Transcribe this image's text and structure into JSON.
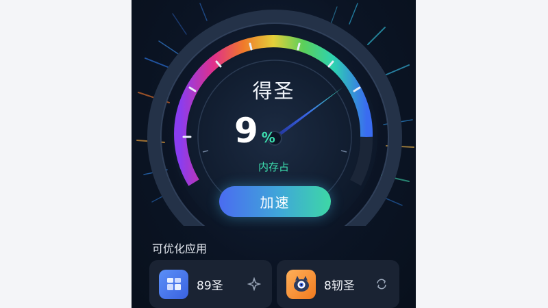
{
  "gauge": {
    "title": "得圣",
    "value": "9",
    "unit": "%",
    "sublabel": "内存占",
    "level_percent": 90
  },
  "boost_button": {
    "label": "加速"
  },
  "apps_section": {
    "title": "可优化应用",
    "items": [
      {
        "label": "89圣",
        "icon": "blocks-icon",
        "action_icon": "sparkle-icon"
      },
      {
        "label": "8轫圣",
        "icon": "cat-mascot-icon",
        "action_icon": "refresh-icon"
      }
    ]
  },
  "colors": {
    "background": "#0b1424",
    "accent_green": "#3de0b0",
    "accent_blue": "#4a6cf0",
    "card": "#1a2333"
  }
}
